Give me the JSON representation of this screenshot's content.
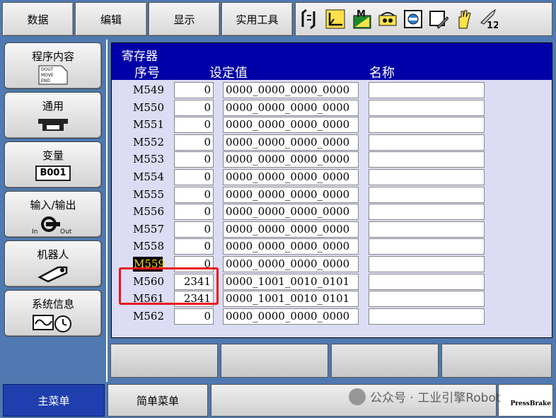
{
  "top_menu": {
    "items": [
      "数据",
      "编辑",
      "显示",
      "实用工具"
    ]
  },
  "toolbar_icons": [
    "jog-coordinate-icon",
    "frame-axis-icon",
    "manual-speed-icon",
    "security-level-icon",
    "page-icon",
    "edit-lock-icon",
    "hand-icon",
    "tool-12-icon"
  ],
  "toolbar_text": {
    "m_label": "M",
    "tool_number": "12"
  },
  "side_nav": {
    "items": [
      {
        "label": "程序内容",
        "icon_text": [
          "DOUT",
          "MOVE",
          "END"
        ]
      },
      {
        "label": "通用"
      },
      {
        "label": "变量",
        "icon_text": "B001"
      },
      {
        "label": "输入/输出",
        "icon_in": "In",
        "icon_out": "Out"
      },
      {
        "label": "机器人"
      },
      {
        "label": "系统信息"
      }
    ]
  },
  "panel": {
    "title": "寄存器",
    "col_no": "序号",
    "col_value": "设定值",
    "col_name": "名称"
  },
  "rows": [
    {
      "id": "M549",
      "value": "0",
      "binary": "0000_0000_0000_0000",
      "name": ""
    },
    {
      "id": "M550",
      "value": "0",
      "binary": "0000_0000_0000_0000",
      "name": ""
    },
    {
      "id": "M551",
      "value": "0",
      "binary": "0000_0000_0000_0000",
      "name": ""
    },
    {
      "id": "M552",
      "value": "0",
      "binary": "0000_0000_0000_0000",
      "name": ""
    },
    {
      "id": "M553",
      "value": "0",
      "binary": "0000_0000_0000_0000",
      "name": ""
    },
    {
      "id": "M554",
      "value": "0",
      "binary": "0000_0000_0000_0000",
      "name": ""
    },
    {
      "id": "M555",
      "value": "0",
      "binary": "0000_0000_0000_0000",
      "name": ""
    },
    {
      "id": "M556",
      "value": "0",
      "binary": "0000_0000_0000_0000",
      "name": ""
    },
    {
      "id": "M557",
      "value": "0",
      "binary": "0000_0000_0000_0000",
      "name": ""
    },
    {
      "id": "M558",
      "value": "0",
      "binary": "0000_0000_0000_0000",
      "name": ""
    },
    {
      "id": "M559",
      "value": "0",
      "binary": "0000_0000_0000_0000",
      "name": "",
      "selected": true
    },
    {
      "id": "M560",
      "value": "2341",
      "binary": "0000_1001_0010_0101",
      "name": ""
    },
    {
      "id": "M561",
      "value": "2341",
      "binary": "0000_1001_0010_0101",
      "name": ""
    },
    {
      "id": "M562",
      "value": "0",
      "binary": "0000_0000_0000_0000",
      "name": ""
    }
  ],
  "status_bar": {
    "main_menu": "主菜单",
    "simple_menu": "简单菜单",
    "press_label": "PressBrake"
  },
  "watermark": "公众号 · 工业引擎Robot",
  "colors": {
    "background_blue": "#4f79b0",
    "panel_dark_blue": "#0000a8",
    "table_bg": "#dcdcf4",
    "highlight_red": "#e8141c",
    "selected_id_text": "#ffd700"
  }
}
